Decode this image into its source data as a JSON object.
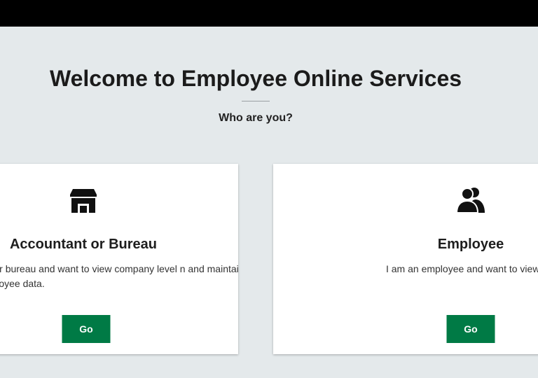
{
  "header": {
    "title": "Welcome to Employee Online Services",
    "subtitle": "Who are you?"
  },
  "cards": [
    {
      "icon": "store-icon",
      "title": "Accountant or Bureau",
      "description": "ant or bureau and want to view company level n and maintain employee data.",
      "button_label": "Go"
    },
    {
      "icon": "users-icon",
      "title": "Employee",
      "description": "I am an employee and want to view my",
      "button_label": "Go"
    }
  ],
  "colors": {
    "accent": "#007a45",
    "background": "#e4e9eb",
    "topbar": "#000000"
  }
}
